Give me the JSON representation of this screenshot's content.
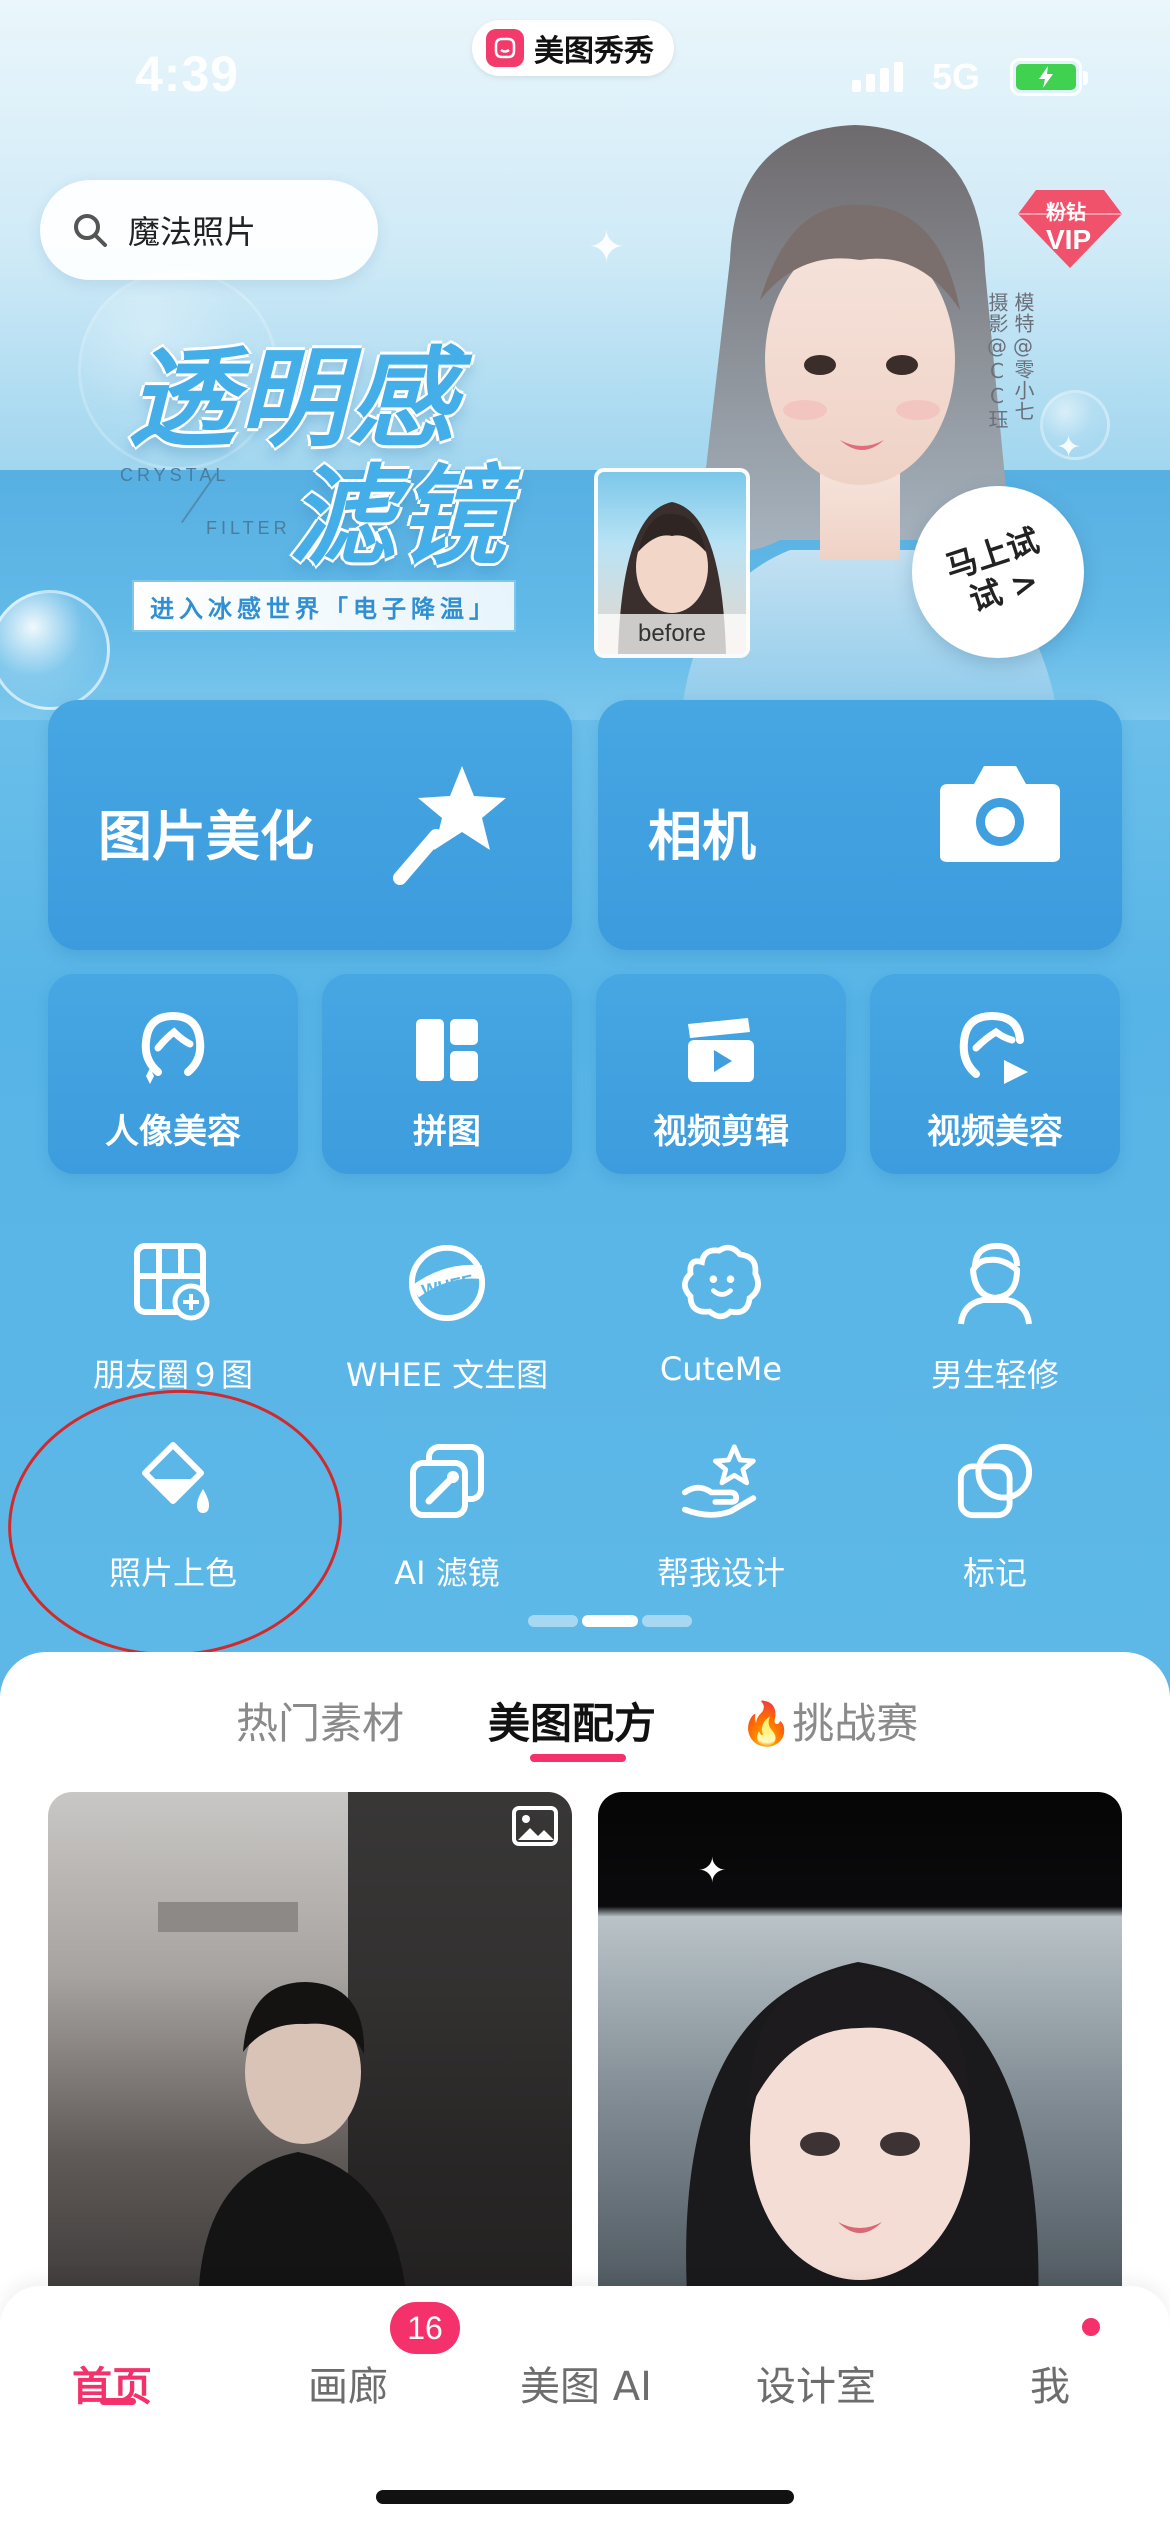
{
  "status_bar": {
    "time": "4:39",
    "network": "5G",
    "app_name": "美图秀秀"
  },
  "banner": {
    "search_placeholder": "魔法照片",
    "title_line1": "透明感",
    "title_line2": "滤镜",
    "crystal_word": "CRYSTAL",
    "filter_word": "FILTER",
    "subtitle": "进入冰感世界「电子降温」",
    "before_label": "before",
    "vip_line1": "粉钻",
    "vip_line2": "VIP",
    "credit_model": "模特@零小七",
    "credit_photo": "摄影@CC珏",
    "try_button": "马上试试 >"
  },
  "main_tools": [
    {
      "label": "图片美化",
      "icon": "magic-wand-icon"
    },
    {
      "label": "相机",
      "icon": "camera-icon"
    }
  ],
  "secondary_tools": [
    {
      "label": "人像美容",
      "icon": "portrait-face-icon"
    },
    {
      "label": "拼图",
      "icon": "collage-grid-icon"
    },
    {
      "label": "视频剪辑",
      "icon": "video-clapper-icon"
    },
    {
      "label": "视频美容",
      "icon": "video-beauty-icon"
    }
  ],
  "tool_grid": [
    {
      "label": "朋友圈９图",
      "icon": "nine-grid-icon"
    },
    {
      "label": "WHEE 文生图",
      "icon": "whee-logo-icon"
    },
    {
      "label": "CuteMe",
      "icon": "cute-face-icon"
    },
    {
      "label": "男生轻修",
      "icon": "male-avatar-icon"
    },
    {
      "label": "照片上色",
      "icon": "paint-bucket-icon"
    },
    {
      "label": "AI 滤镜",
      "icon": "ai-filter-icon"
    },
    {
      "label": "帮我设计",
      "icon": "design-star-hand-icon"
    },
    {
      "label": "标记",
      "icon": "overlap-squares-icon"
    }
  ],
  "feed_tabs": [
    {
      "label": "热门素材",
      "active": false
    },
    {
      "label": "美图配方",
      "active": true
    },
    {
      "label": "🔥挑战赛",
      "active": false
    }
  ],
  "bottom_nav": {
    "items": [
      {
        "label": "首页",
        "active": true
      },
      {
        "label": "画廊",
        "active": false
      },
      {
        "label": "美图 AI",
        "active": false
      },
      {
        "label": "设计室",
        "active": false
      },
      {
        "label": "我",
        "active": false
      }
    ],
    "gallery_badge": "16"
  },
  "colors": {
    "accent_pink": "#f4316a",
    "tile_blue": "#3f9fdf",
    "annotation_red": "#d22a2a"
  }
}
